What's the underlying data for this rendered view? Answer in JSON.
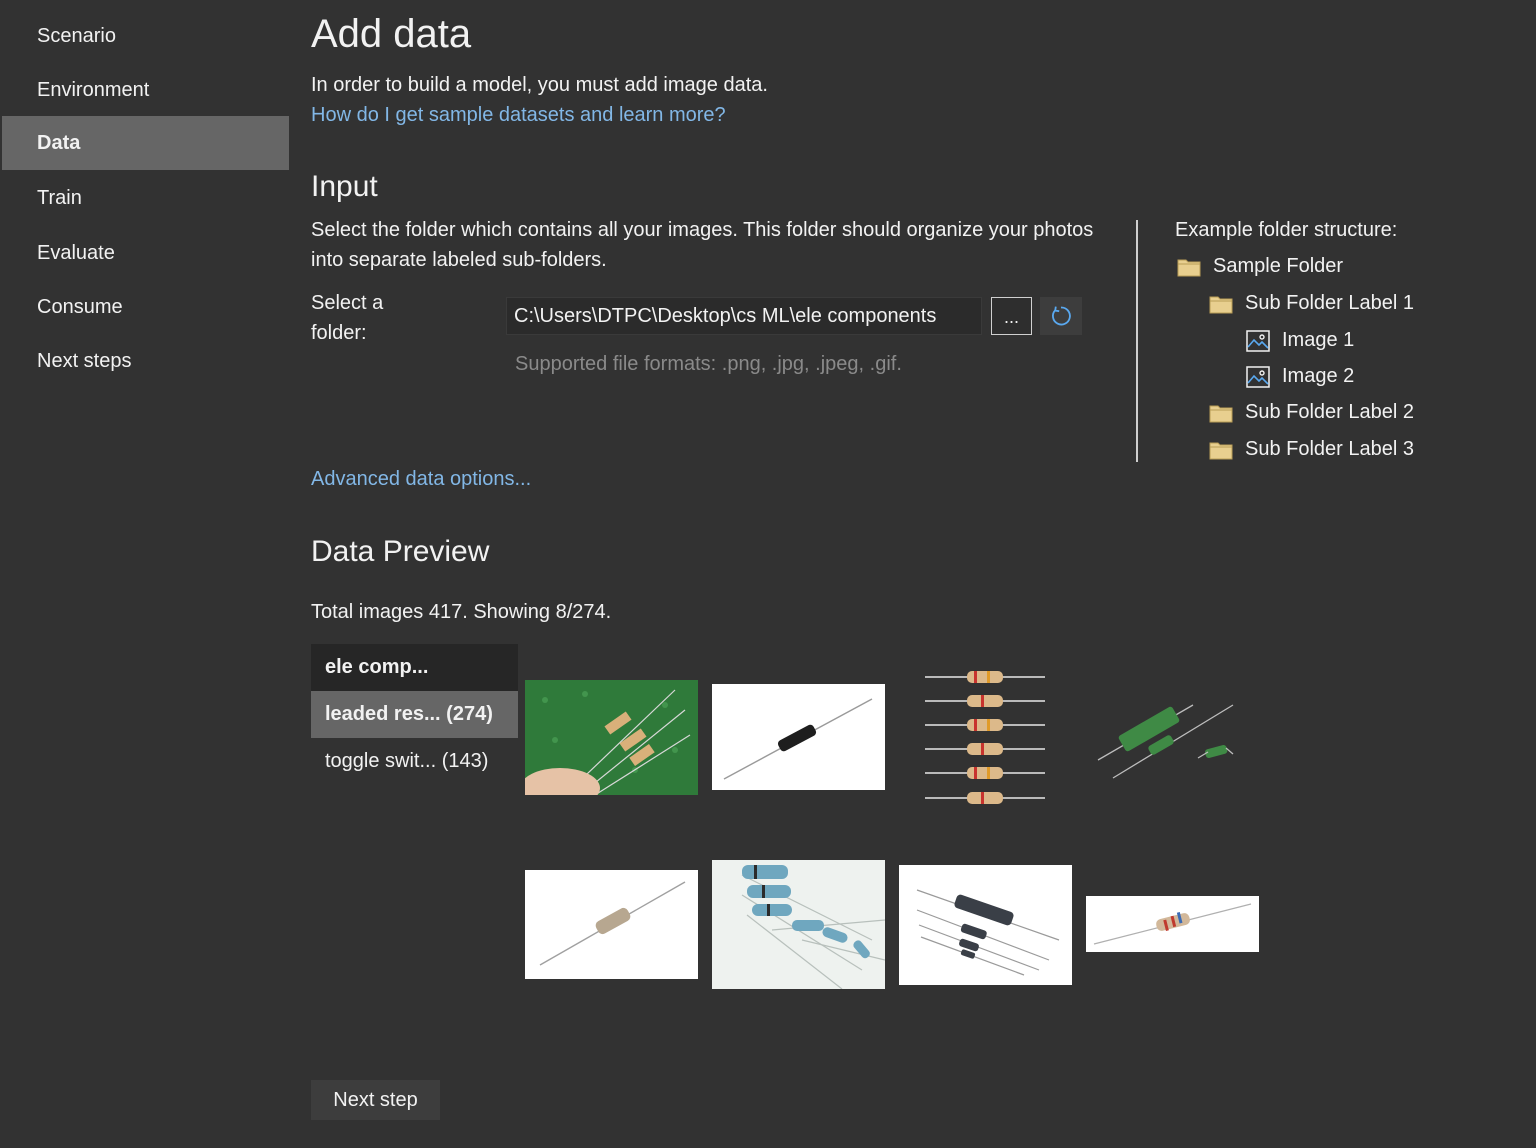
{
  "sidebar": {
    "items": [
      {
        "label": "Scenario"
      },
      {
        "label": "Environment"
      },
      {
        "label": "Data"
      },
      {
        "label": "Train"
      },
      {
        "label": "Evaluate"
      },
      {
        "label": "Consume"
      },
      {
        "label": "Next steps"
      }
    ],
    "active": "Data"
  },
  "main": {
    "title": "Add data",
    "intro": "In order to build a model, you must add image data.",
    "help_link": "How do I get sample datasets and learn more?",
    "input": {
      "heading": "Input",
      "desc_line1": "Select the folder which contains all your images. This folder should organize your photos",
      "desc_line2": "into separate labeled sub-folders.",
      "label_line1": "Select a",
      "label_line2": "folder:",
      "path_value": "C:\\Users\\DTPC\\Desktop\\cs ML\\ele components",
      "browse_label": "...",
      "formats_hint": "Supported file formats: .png, .jpg, .jpeg, .gif."
    },
    "example": {
      "heading": "Example folder structure:",
      "tree": [
        {
          "label": "Sample Folder",
          "icon": "folder-icon"
        },
        {
          "label": "Sub Folder Label 1",
          "icon": "folder-icon"
        },
        {
          "label": "Image 1",
          "icon": "image-icon"
        },
        {
          "label": "Image 2",
          "icon": "image-icon"
        },
        {
          "label": "Sub Folder Label 2",
          "icon": "folder-icon"
        },
        {
          "label": "Sub Folder Label 3",
          "icon": "folder-icon"
        }
      ]
    },
    "advanced_link": "Advanced data options...",
    "preview": {
      "heading": "Data Preview",
      "summary": "Total images 417. Showing 8/274.",
      "folders": {
        "header": "ele comp...",
        "items": [
          {
            "label": "leaded res... (274)",
            "selected": true
          },
          {
            "label": "toggle swit... (143)",
            "selected": false
          }
        ]
      }
    },
    "next_label": "Next step"
  },
  "colors": {
    "background": "#323232",
    "active_nav": "#666666",
    "link": "#82b7e6",
    "folder_icon": "#e8cf8f"
  }
}
